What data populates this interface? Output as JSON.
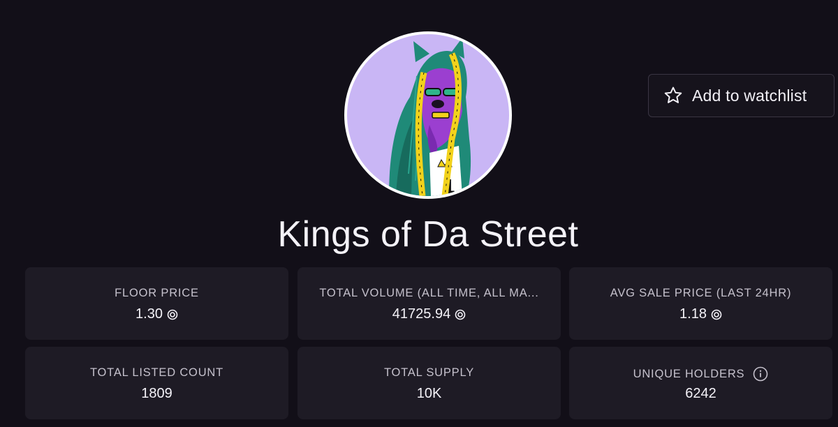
{
  "collection": {
    "name": "Kings of Da Street",
    "avatar_icon": "collection-avatar-lion-hoodie"
  },
  "watchlist": {
    "label": "Add to watchlist",
    "icon": "star-outline-icon"
  },
  "currency_icon": "sol-coin-icon",
  "stats": [
    {
      "label": "FLOOR PRICE",
      "value": "1.30",
      "has_coin": true
    },
    {
      "label": "TOTAL VOLUME (ALL TIME, ALL MA...",
      "value": "41725.94",
      "has_coin": true
    },
    {
      "label": "AVG SALE PRICE (LAST 24HR)",
      "value": "1.18",
      "has_coin": true
    },
    {
      "label": "TOTAL LISTED COUNT",
      "value": "1809",
      "has_coin": false
    },
    {
      "label": "TOTAL SUPPLY",
      "value": "10K",
      "has_coin": false
    },
    {
      "label": "UNIQUE HOLDERS",
      "value": "6242",
      "has_coin": false,
      "has_info": true
    }
  ],
  "colors": {
    "background": "#120f18",
    "card": "#1e1b25",
    "avatar_bg": "#c9b6f5",
    "hoodie": "#1f8a78",
    "accent_yellow": "#f2d21b",
    "lion_purple": "#9b3fd0"
  }
}
